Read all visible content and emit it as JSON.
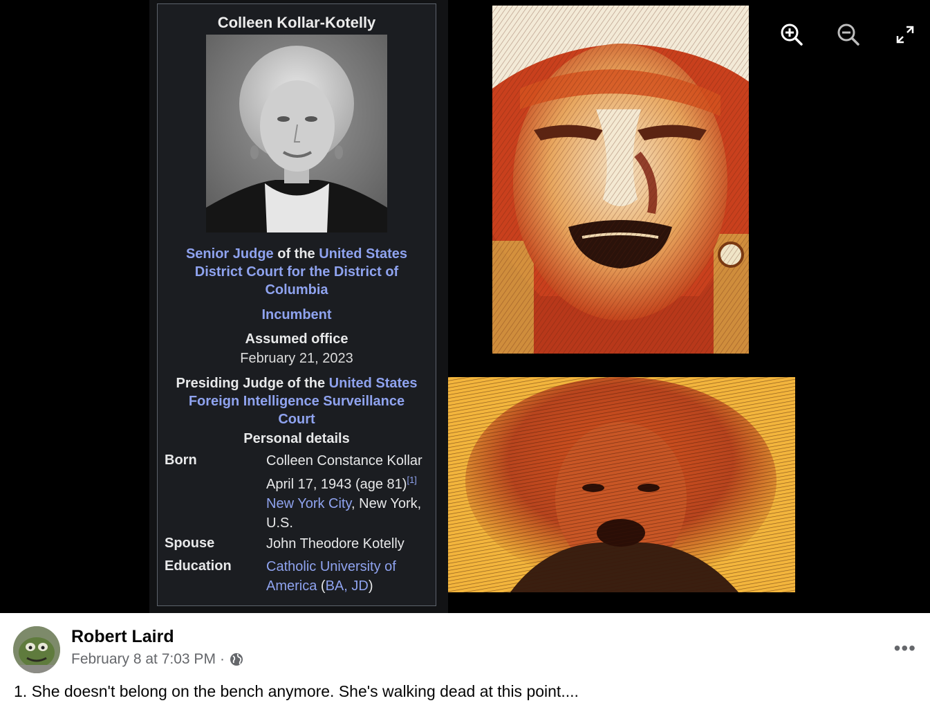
{
  "viewer": {
    "controls": {
      "zoom_in_icon": "zoom-in-icon",
      "zoom_out_icon": "zoom-out-icon",
      "fullscreen_icon": "expand-icon"
    },
    "infobox": {
      "name": "Colleen Kollar-Kotelly",
      "office1": {
        "part1": "Senior Judge",
        "part2": " of the ",
        "part3": "United States",
        "line2": "District Court for the District of",
        "line3": "Columbia"
      },
      "incumbent": "Incumbent",
      "assumed_label": "Assumed office",
      "assumed_date": "February 21, 2023",
      "office2": {
        "part1": "Presiding Judge of the ",
        "part2": "United States",
        "line2": "Foreign Intelligence Surveillance",
        "line3": "Court"
      },
      "personal_heading": "Personal details",
      "born_label": "Born",
      "born_name": "Colleen Constance Kollar",
      "born_date": "April 17, 1943 (age 81)",
      "born_cite": "[1]",
      "born_city": "New York City",
      "born_rest": ", New York,",
      "born_country": "U.S.",
      "spouse_label": "Spouse",
      "spouse_value": "John Theodore Kotelly",
      "education_label": "Education",
      "education_link1": "Catholic University of",
      "education_link2": "America",
      "education_open": " (",
      "education_degrees": "BA, JD",
      "education_close": ")"
    }
  },
  "post": {
    "author": "Robert Laird",
    "timestamp": "February 8 at 7:03 PM",
    "separator": "·",
    "privacy_icon": "globe-icon",
    "more_label": "•••",
    "caption": "1. She doesn't belong on the bench anymore. She's walking dead at this point...."
  },
  "colors": {
    "link": "#8fa3ef",
    "infobox_bg": "#1b1d21",
    "meta_gray": "#65676b"
  }
}
